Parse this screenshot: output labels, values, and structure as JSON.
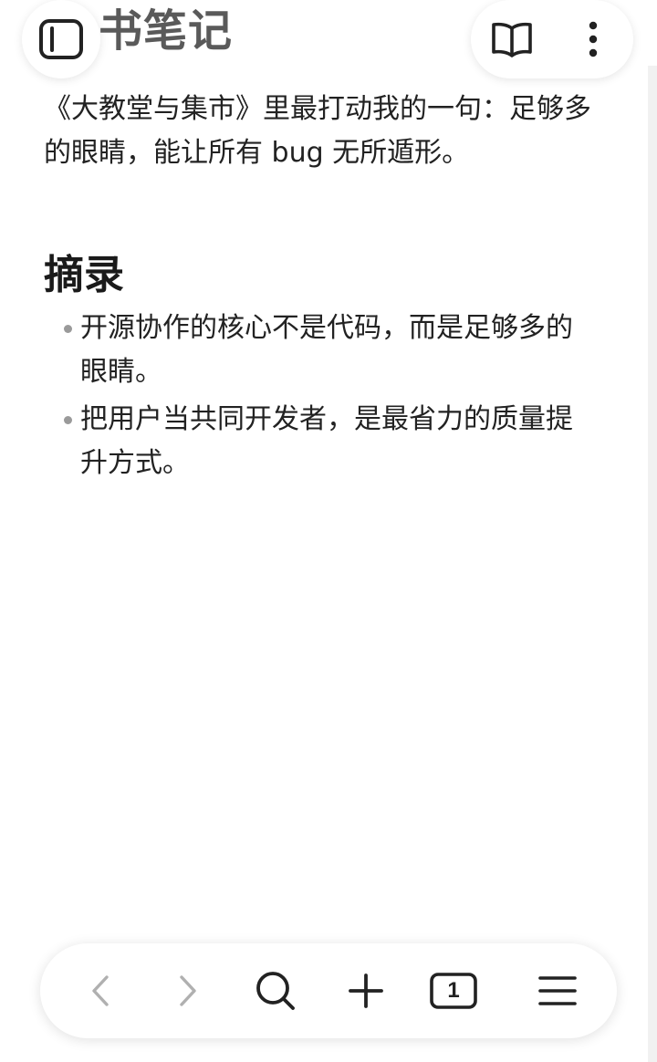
{
  "app": {
    "title": "书笔记"
  },
  "note": {
    "intro": "《大教堂与集市》里最打动我的一句：足够多的眼睛，能让所有 bug 无所遁形。",
    "section_heading": "摘录",
    "bullets": [
      "开源协作的核心不是代码，而是足够多的眼睛。",
      "把用户当共同开发者，是最省力的质量提升方式。"
    ]
  },
  "toolbar": {
    "tab_count": "1"
  },
  "icons": {
    "sidebar": "sidebar-toggle-icon",
    "reader": "book-open-icon",
    "more": "more-vertical-icon",
    "back": "chevron-left-icon",
    "forward": "chevron-right-icon",
    "search": "search-icon",
    "new_tab": "plus-icon",
    "tabs": "tabs-icon",
    "menu": "menu-icon"
  },
  "colors": {
    "title": "#5a5a5a",
    "disabled_icon": "#b0b0b0",
    "icon": "#222222"
  }
}
